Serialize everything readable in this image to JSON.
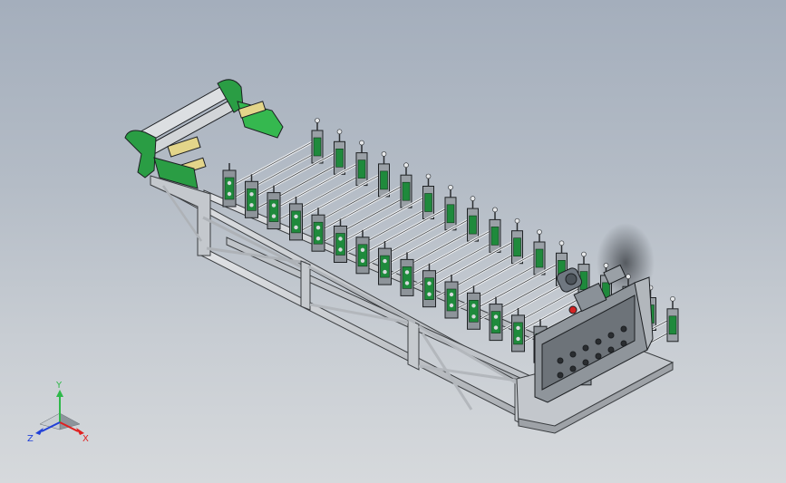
{
  "view": {
    "background_top": "#a4aebc",
    "background_bottom": "#d6d9dc"
  },
  "model": {
    "frame_color": "#c9ccd0",
    "frame_edge_color": "#3a3d40",
    "roller_stand_color": "#1f8a3c",
    "cap_color": "#e3d58a",
    "motor_color": "#6f7780",
    "stand_count": 17
  },
  "triad": {
    "y_label": "Y",
    "x_label": "X",
    "z_label": "Z",
    "y_color": "#2fb84a",
    "x_color": "#e02020",
    "z_color": "#2040d8"
  }
}
